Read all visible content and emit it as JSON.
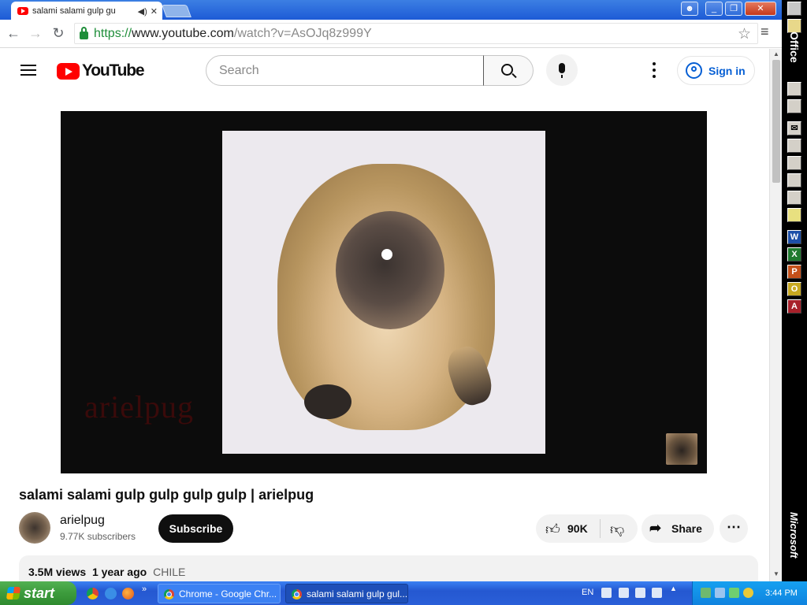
{
  "browser": {
    "tab_title": "salami salami gulp gu",
    "tab_audio_icon": "speaker-icon",
    "tab_close": "✕",
    "url_scheme": "https://",
    "url_host": "www.youtube.com",
    "url_path": "/watch?v=AsOJq8z999Y"
  },
  "youtube": {
    "logo_text": "YouTube",
    "search_placeholder": "Search",
    "signin_label": "Sign in",
    "watermark": "arielpug",
    "video_title": "salami salami gulp gulp gulp gulp | arielpug",
    "channel_name": "arielpug",
    "subscribers": "9.77K subscribers",
    "subscribe_label": "Subscribe",
    "like_count": "90K",
    "share_label": "Share",
    "views": "3.5M views",
    "age": "1 year ago",
    "location": "CHILE",
    "brand_red": "#ff0000",
    "link_blue": "#065fd4"
  },
  "office_bar": {
    "label": "Office",
    "footer": "Microsoft"
  },
  "taskbar": {
    "start_label": "start",
    "task_1": "Chrome - Google Chr...",
    "task_2": "salami salami gulp gul...",
    "lang": "EN",
    "clock": "3:44 PM"
  }
}
